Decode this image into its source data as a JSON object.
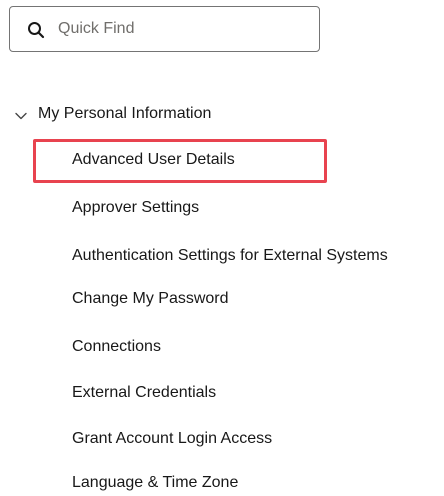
{
  "search": {
    "placeholder": "Quick Find",
    "value": ""
  },
  "section": {
    "label": "My Personal Information",
    "expanded": true,
    "items": [
      {
        "label": "Advanced User Details",
        "highlighted": true
      },
      {
        "label": "Approver Settings"
      },
      {
        "label": "Authentication Settings for External Systems"
      },
      {
        "label": "Change My Password"
      },
      {
        "label": "Connections"
      },
      {
        "label": "External Credentials"
      },
      {
        "label": "Grant Account Login Access"
      },
      {
        "label": "Language & Time Zone"
      }
    ]
  },
  "colors": {
    "highlight": "#e8434f",
    "text": "#181818",
    "placeholder": "#706e6b",
    "border": "#747474"
  },
  "icons": {
    "search": "search-icon",
    "chevron": "chevron-down-icon"
  }
}
